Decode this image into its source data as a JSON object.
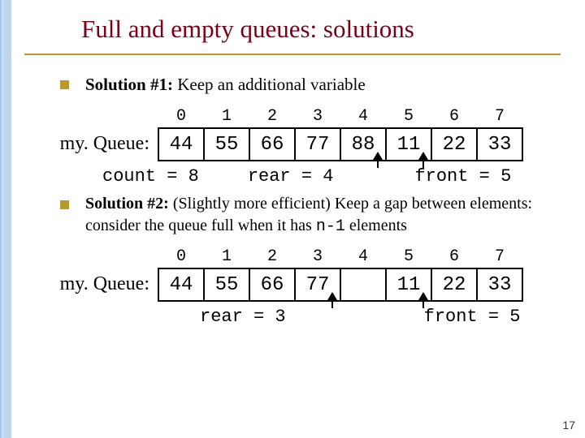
{
  "title": "Full and empty queues: solutions",
  "bullet1_pre": "Solution #1:",
  "bullet1_post": " Keep an additional variable",
  "bullet2_pre": "Solution #2:",
  "bullet2_mid": " (Slightly more efficient) Keep a gap between elements: consider the queue full when it has ",
  "bullet2_code": "n-1",
  "bullet2_end": " elements",
  "queue1": {
    "label": "my. Queue:",
    "idx": [
      "0",
      "1",
      "2",
      "3",
      "4",
      "5",
      "6",
      "7"
    ],
    "cells": [
      "44",
      "55",
      "66",
      "77",
      "88",
      "11",
      "22",
      "33"
    ],
    "count": "count = 8",
    "rear": "rear = 4",
    "front": "front = 5"
  },
  "queue2": {
    "label": "my. Queue:",
    "idx": [
      "0",
      "1",
      "2",
      "3",
      "4",
      "5",
      "6",
      "7"
    ],
    "cells": [
      "44",
      "55",
      "66",
      "77",
      "",
      "11",
      "22",
      "33"
    ],
    "rear": "rear = 3",
    "front": "front = 5"
  },
  "page": "17"
}
